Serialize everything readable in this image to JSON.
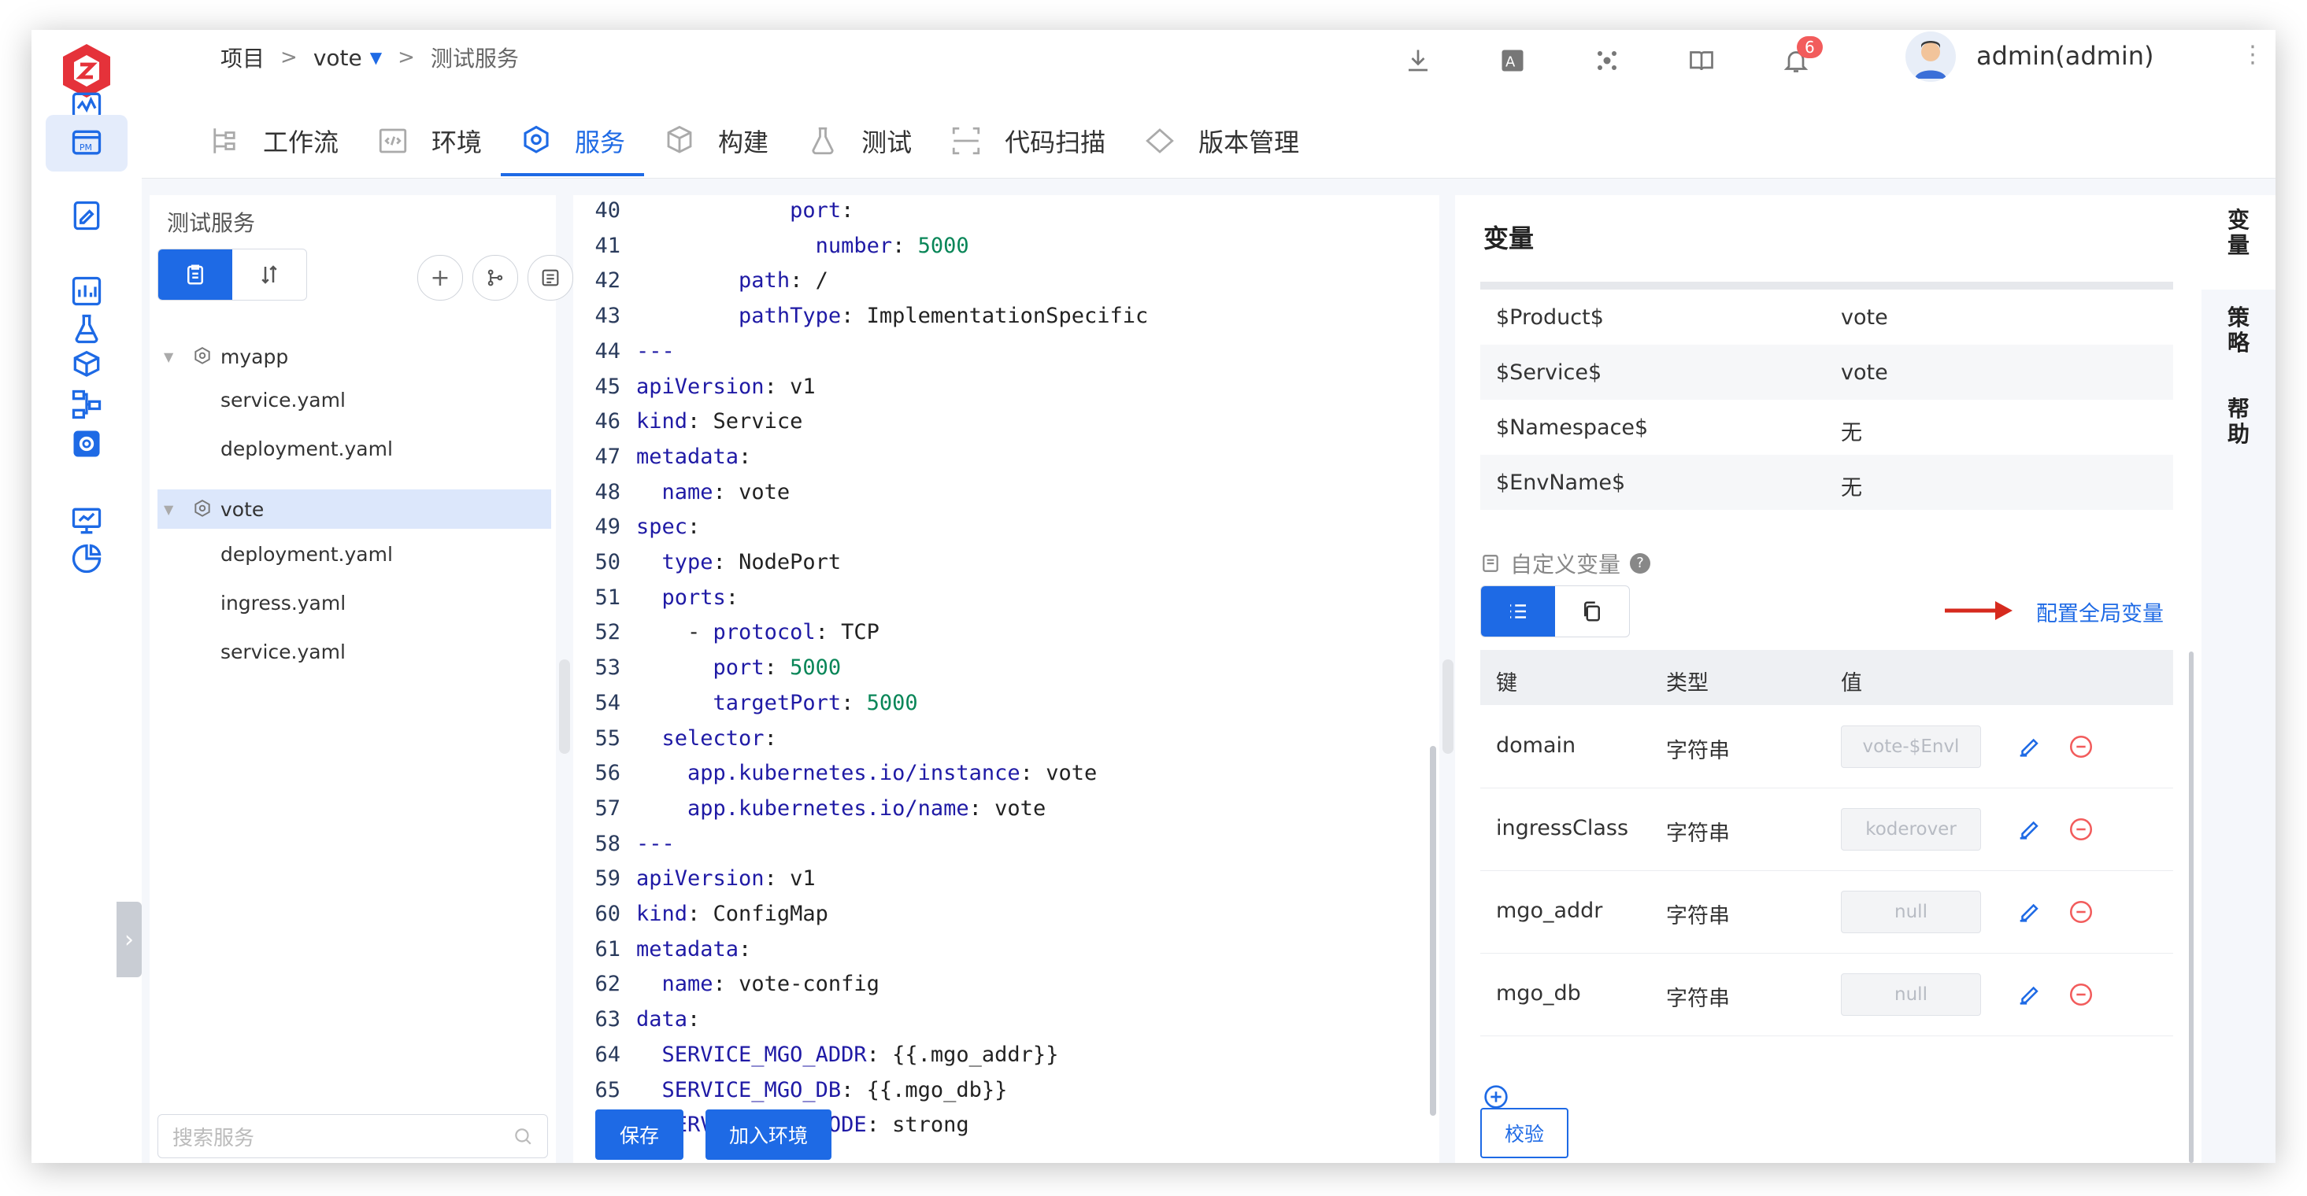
{
  "breadcrumb": {
    "project": "项目",
    "product": "vote",
    "page": "测试服务"
  },
  "header": {
    "notifications": "6",
    "user": "admin(admin)"
  },
  "tabs": [
    "工作流",
    "环境",
    "服务",
    "构建",
    "测试",
    "代码扫描",
    "版本管理"
  ],
  "active_tab": "服务",
  "tree": {
    "title": "测试服务",
    "services": [
      {
        "name": "myapp",
        "files": [
          "service.yaml",
          "deployment.yaml"
        ]
      },
      {
        "name": "vote",
        "files": [
          "deployment.yaml",
          "ingress.yaml",
          "service.yaml"
        ]
      }
    ],
    "selected": "vote",
    "search_placeholder": "搜索服务"
  },
  "editor": {
    "lines": [
      {
        "n": "40",
        "i": 12,
        "k": "port",
        "v": ""
      },
      {
        "n": "41",
        "i": 14,
        "k": "number",
        "v": "5000",
        "num": true
      },
      {
        "n": "42",
        "i": 8,
        "k": "path",
        "v": "/"
      },
      {
        "n": "43",
        "i": 8,
        "k": "pathType",
        "v": "ImplementationSpecific"
      },
      {
        "n": "44",
        "i": 0,
        "raw": "---"
      },
      {
        "n": "45",
        "i": 0,
        "k": "apiVersion",
        "v": "v1"
      },
      {
        "n": "46",
        "i": 0,
        "k": "kind",
        "v": "Service"
      },
      {
        "n": "47",
        "i": 0,
        "k": "metadata",
        "v": ""
      },
      {
        "n": "48",
        "i": 2,
        "k": "name",
        "v": "vote"
      },
      {
        "n": "49",
        "i": 0,
        "k": "spec",
        "v": ""
      },
      {
        "n": "50",
        "i": 2,
        "k": "type",
        "v": "NodePort"
      },
      {
        "n": "51",
        "i": 2,
        "k": "ports",
        "v": ""
      },
      {
        "n": "52",
        "i": 4,
        "dash": true,
        "k": "protocol",
        "v": "TCP"
      },
      {
        "n": "53",
        "i": 6,
        "k": "port",
        "v": "5000",
        "num": true
      },
      {
        "n": "54",
        "i": 6,
        "k": "targetPort",
        "v": "5000",
        "num": true
      },
      {
        "n": "55",
        "i": 2,
        "k": "selector",
        "v": ""
      },
      {
        "n": "56",
        "i": 4,
        "k": "app.kubernetes.io/instance",
        "v": "vote"
      },
      {
        "n": "57",
        "i": 4,
        "k": "app.kubernetes.io/name",
        "v": "vote"
      },
      {
        "n": "58",
        "i": 0,
        "raw": "---"
      },
      {
        "n": "59",
        "i": 0,
        "k": "apiVersion",
        "v": "v1"
      },
      {
        "n": "60",
        "i": 0,
        "k": "kind",
        "v": "ConfigMap"
      },
      {
        "n": "61",
        "i": 0,
        "k": "metadata",
        "v": ""
      },
      {
        "n": "62",
        "i": 2,
        "k": "name",
        "v": "vote-config"
      },
      {
        "n": "63",
        "i": 0,
        "k": "data",
        "v": ""
      },
      {
        "n": "64",
        "i": 2,
        "k": "SERVICE_MGO_ADDR",
        "v": "{{.mgo_addr}}"
      },
      {
        "n": "65",
        "i": 2,
        "k": "SERVICE_MGO_DB",
        "v": "{{.mgo_db}}"
      },
      {
        "n": "66",
        "i": 2,
        "k": "SERVICE_MGO_MODE",
        "v": "strong"
      }
    ],
    "save_label": "保存",
    "join_env_label": "加入环境"
  },
  "vars": {
    "title": "变量",
    "system": [
      {
        "key": "$Product$",
        "value": "vote"
      },
      {
        "key": "$Service$",
        "value": "vote"
      },
      {
        "key": "$Namespace$",
        "value": "无"
      },
      {
        "key": "$EnvName$",
        "value": "无"
      }
    ],
    "custom_label": "自定义变量",
    "config_global_label": "配置全局变量",
    "columns": [
      "键",
      "类型",
      "值"
    ],
    "custom": [
      {
        "key": "domain",
        "type": "字符串",
        "value": "vote-$Envl"
      },
      {
        "key": "ingressClass",
        "type": "字符串",
        "value": "koderover"
      },
      {
        "key": "mgo_addr",
        "type": "字符串",
        "value": "null"
      },
      {
        "key": "mgo_db",
        "type": "字符串",
        "value": "null"
      }
    ],
    "validate_label": "校验"
  },
  "side_tabs": [
    "变量",
    "策略",
    "帮助"
  ],
  "colors": {
    "accent": "#1e6ae5",
    "danger": "#f25c5c",
    "arrow": "#d62a1e"
  }
}
